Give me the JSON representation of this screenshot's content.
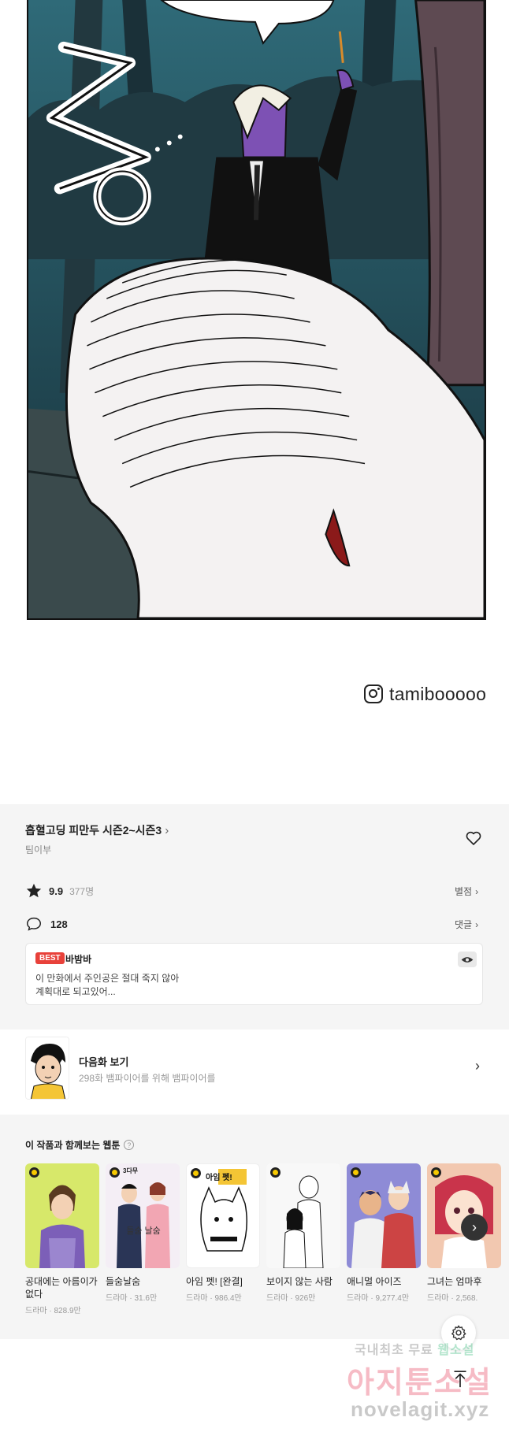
{
  "credit": {
    "handle": "tamibooooo"
  },
  "series": {
    "title": "흡혈고딩 피만두 시즌2~시즌3",
    "author": "팀이부"
  },
  "rating": {
    "score": "9.9",
    "count": "377명",
    "link": "별점"
  },
  "comments": {
    "count": "128",
    "link": "댓글"
  },
  "best_comment": {
    "badge": "BEST",
    "user": "바밤바",
    "line1": "이 만화에서 주인공은 절대 죽지 않아",
    "line2": "계획대로 되고있어..."
  },
  "next_episode": {
    "title": "다음화 보기",
    "desc": "298화 뱀파이어를 위해 뱀파이어를"
  },
  "recommend": {
    "heading": "이 작품과 함께보는 웹툰",
    "items": [
      {
        "title": "공대에는 아름이가 없다",
        "meta": "드라마 · 828.9만",
        "bg": "#d7e86a"
      },
      {
        "title": "들숨날숨",
        "meta": "드라마 · 31.6만",
        "bg": "#f4eef5",
        "badge": "3다무",
        "art": "들숨 날숨"
      },
      {
        "title": "아임 펫! [완결]",
        "meta": "드라마 · 986.4만",
        "bg": "#ffffff",
        "art": "아임 펫!"
      },
      {
        "title": "보이지 않는 사람",
        "meta": "드라마 · 926만",
        "bg": "#f8f8f8"
      },
      {
        "title": "애니멀 아이즈",
        "meta": "드라마 · 9,277.4만",
        "bg": "#8e8bd6"
      },
      {
        "title": "그녀는 엄마후",
        "meta": "드라마 · 2,568.",
        "bg": "#f2c8b0"
      }
    ]
  },
  "watermark": {
    "line1a": "국내최초 무료 ",
    "line1b": "웹소설",
    "line2": "아지툰소설",
    "line3": "novelagit.xyz"
  },
  "colors": {
    "best": "#e8413a",
    "panel_bg": "#f5f5f5",
    "comic_sky": "#1d3c47"
  }
}
